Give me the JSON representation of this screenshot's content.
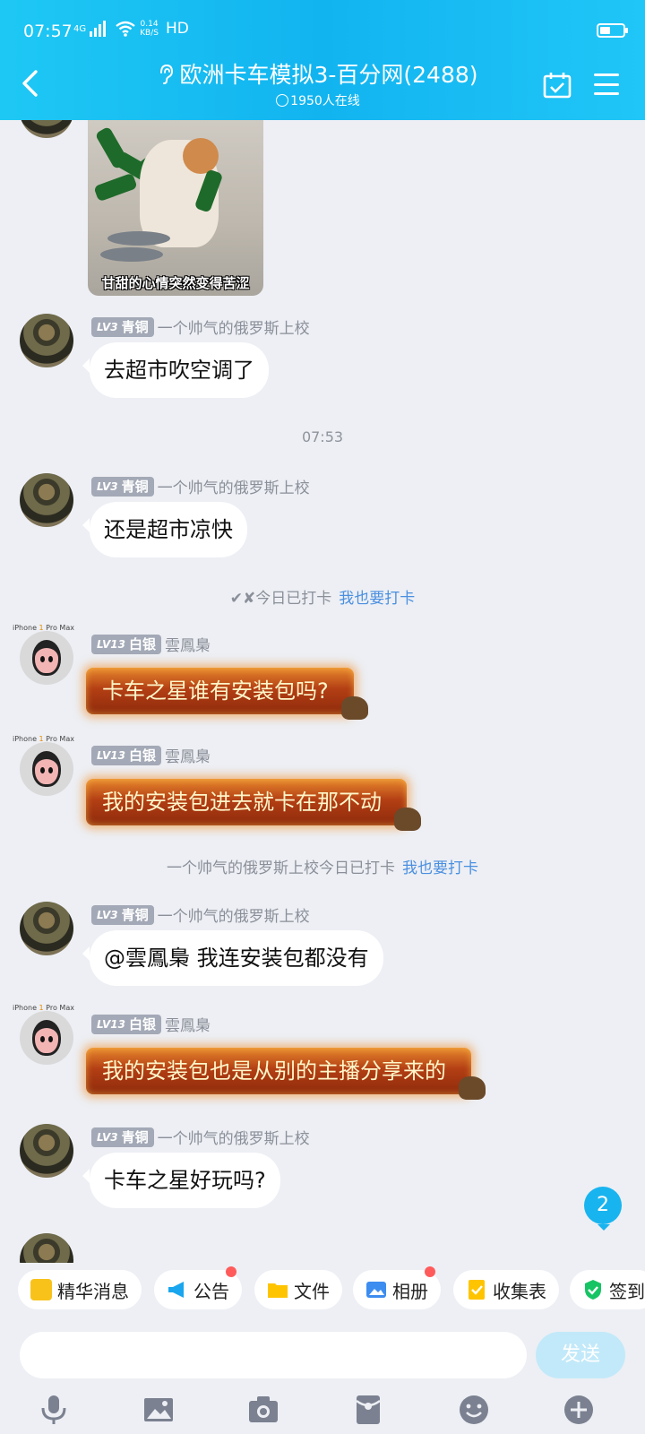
{
  "status_bar": {
    "time": "07:57",
    "network": "4G",
    "speed": "0.14",
    "speed_unit": "KB/S",
    "hd": "HD"
  },
  "header": {
    "title": "欧洲卡车模拟3-百分网(2488)",
    "online": "1950人在线"
  },
  "messages": [
    {
      "type": "sticker",
      "caption": "甘甜的心情突然变得苦涩"
    },
    {
      "type": "text",
      "level": "LV3",
      "rank": "青铜",
      "name": "一个帅气的俄罗斯上校",
      "text": "去超市吹空调了"
    },
    {
      "type": "time",
      "text": "07:53"
    },
    {
      "type": "text",
      "level": "LV3",
      "rank": "青铜",
      "name": "一个帅气的俄罗斯上校",
      "text": "还是超市凉快"
    },
    {
      "type": "notice",
      "text": "✔✘今日已打卡",
      "link": "我也要打卡"
    },
    {
      "type": "fire",
      "device": [
        "iPhone ",
        "1",
        " Pro Max"
      ],
      "level": "LV13",
      "rank": "白银",
      "name": "雲鳳梟",
      "text": "卡车之星谁有安装包吗?"
    },
    {
      "type": "fire",
      "device": [
        "iPhone ",
        "1",
        " Pro Max"
      ],
      "level": "LV13",
      "rank": "白银",
      "name": "雲鳳梟",
      "text": "我的安装包进去就卡在那不动"
    },
    {
      "type": "notice",
      "text": "一个帅气的俄罗斯上校今日已打卡",
      "link": "我也要打卡"
    },
    {
      "type": "text",
      "level": "LV3",
      "rank": "青铜",
      "name": "一个帅气的俄罗斯上校",
      "text": "@雲鳳梟 我连安装包都没有"
    },
    {
      "type": "fire",
      "device": [
        "iPhone ",
        "1",
        " Pro Max"
      ],
      "level": "LV13",
      "rank": "白银",
      "name": "雲鳳梟",
      "text": "我的安装包也是从别的主播分享来的"
    },
    {
      "type": "text",
      "level": "LV3",
      "rank": "青铜",
      "name": "一个帅气的俄罗斯上校",
      "text": "卡车之星好玩吗?"
    }
  ],
  "unread_count": "2",
  "quick_actions": [
    {
      "label": "精华消息",
      "icon": "essence-icon",
      "color": "#f9c21a"
    },
    {
      "label": "公告",
      "icon": "megaphone-icon",
      "color": "#1aa6ee",
      "dot": true
    },
    {
      "label": "文件",
      "icon": "folder-icon",
      "color": "#ffc400"
    },
    {
      "label": "相册",
      "icon": "album-icon",
      "color": "#3d8cf0",
      "dot": true
    },
    {
      "label": "收集表",
      "icon": "form-icon",
      "color": "#ffc400"
    },
    {
      "label": "签到",
      "icon": "checkin-icon",
      "color": "#17c464"
    }
  ],
  "composer": {
    "send_label": "发送"
  },
  "toolbar": [
    "mic-icon",
    "image-icon",
    "camera-icon",
    "red-packet-icon",
    "emoji-icon",
    "plus-icon"
  ]
}
